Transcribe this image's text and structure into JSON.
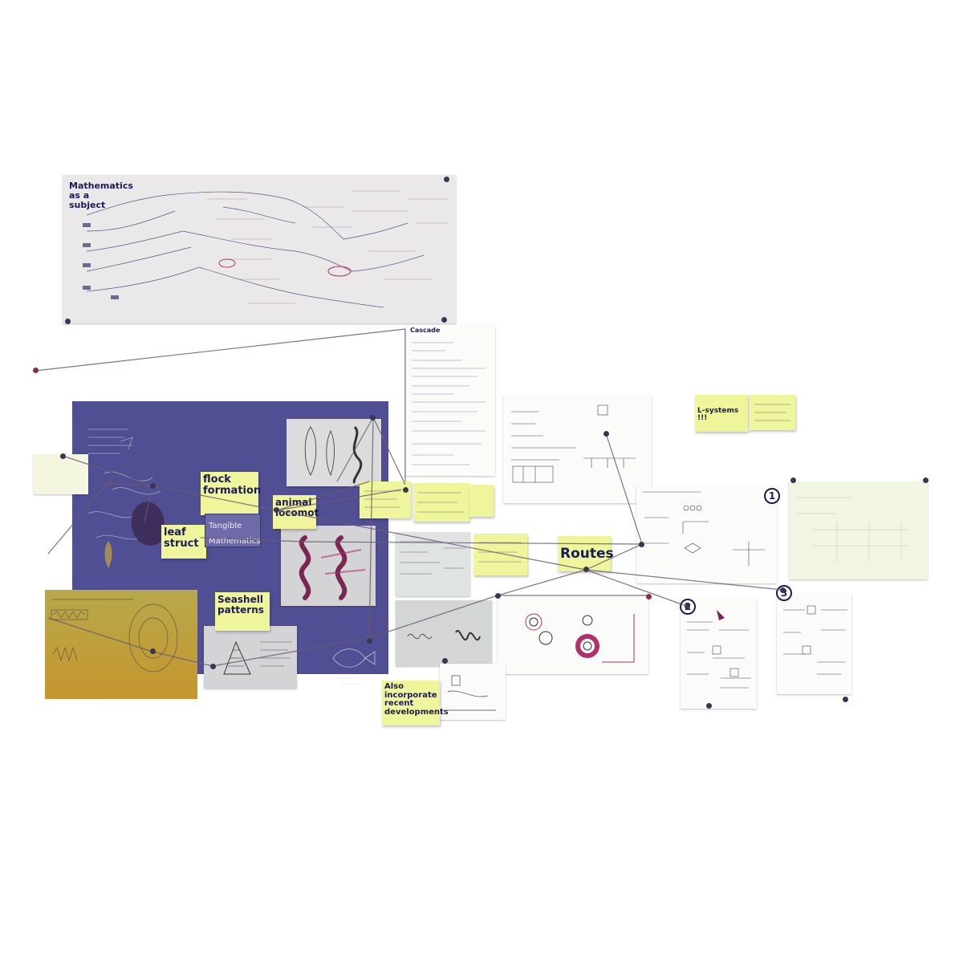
{
  "board": {
    "math_sheet_title": "Mathematics as a subject",
    "center_note": "Tangible Mathematics",
    "cascade_heading": "Cascade"
  },
  "stickies": {
    "flock": "flock formation",
    "leaf": "leaf struct",
    "animal": "animal locomot",
    "seashell": "Seashell patterns",
    "routes": "Routes",
    "recent": "Also incorporate recent developments",
    "lsystems": "L-systems !!!"
  },
  "markers": [
    "1",
    "2",
    "3"
  ],
  "colors": {
    "blue_board": "#504f93",
    "ochre_board": "#b3a43e",
    "sticky": "#eef59a",
    "ink": "#1d1b55",
    "string": "#6a5a70",
    "magenta_ink": "#b0306a"
  }
}
